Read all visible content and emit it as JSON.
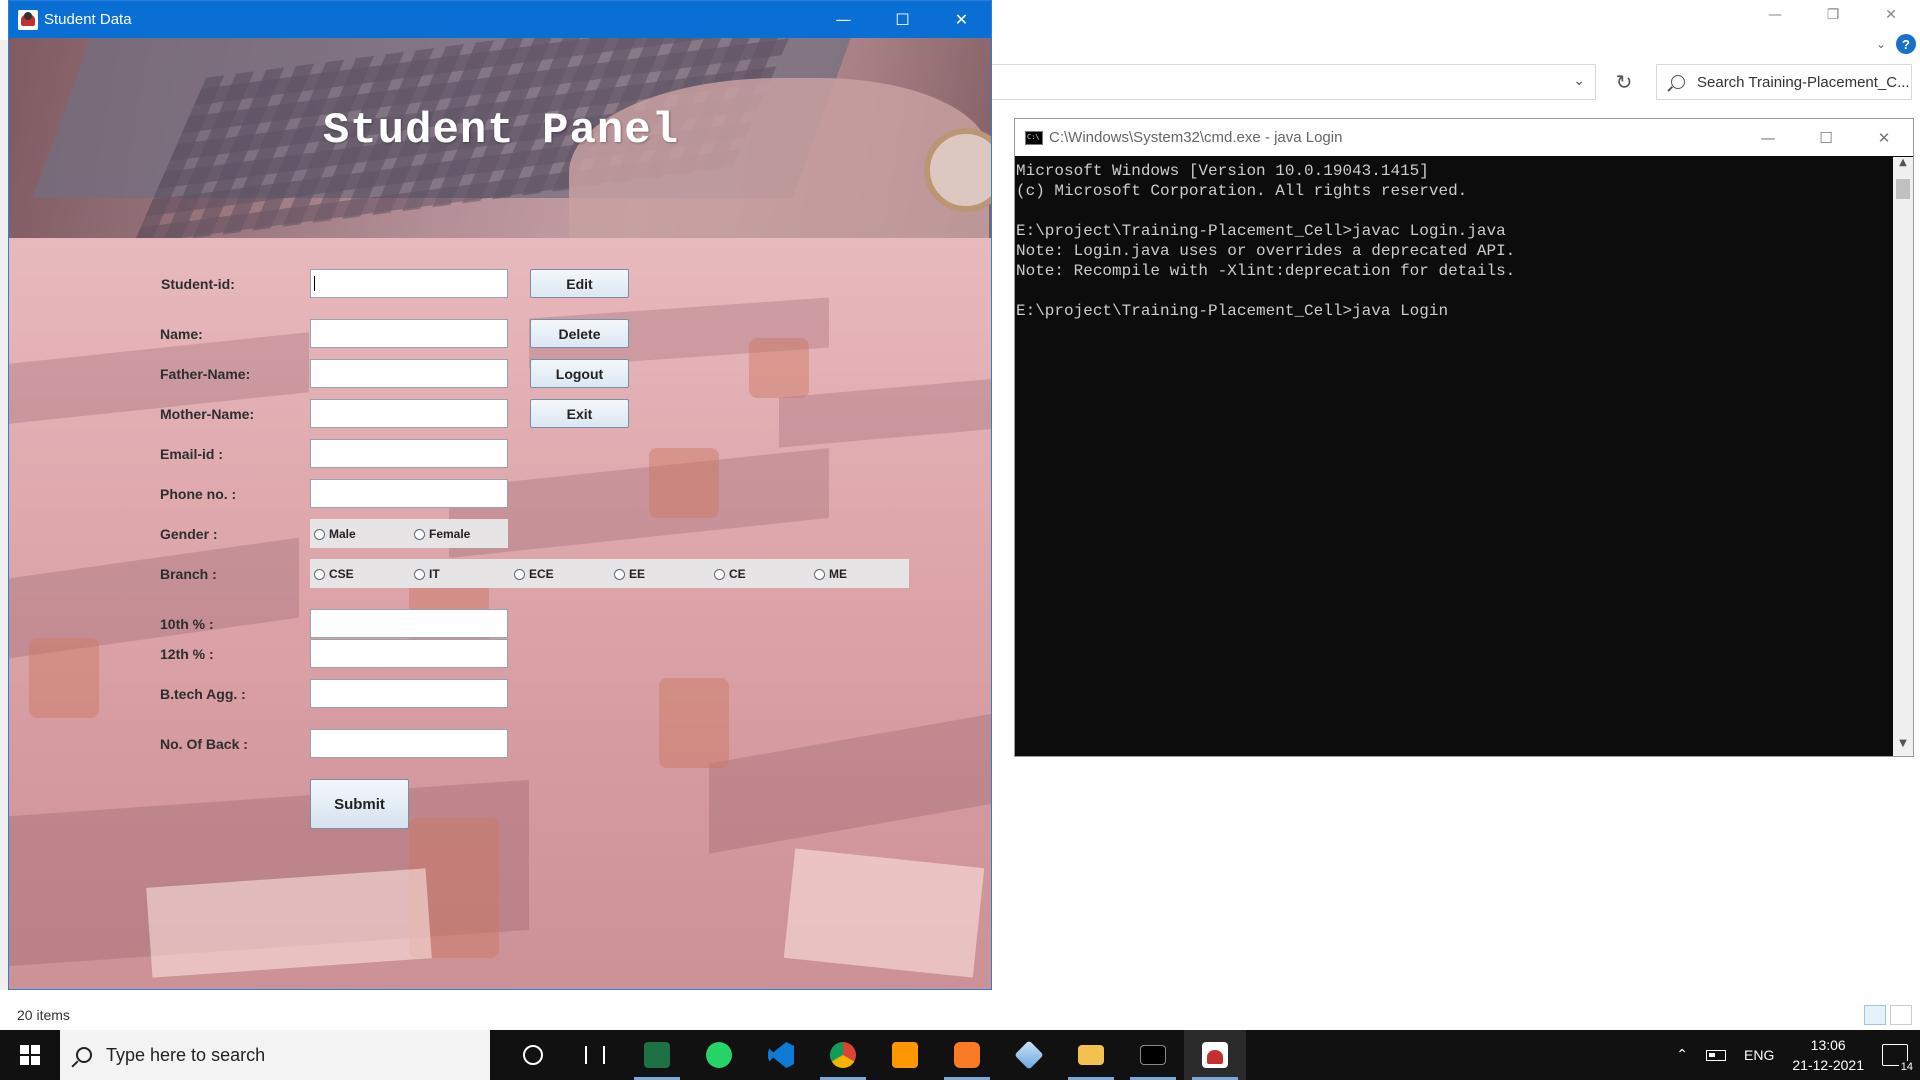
{
  "explorer": {
    "search_placeholder": "Search Training-Placement_C...",
    "status_items": "20 items"
  },
  "java_window": {
    "title": "Student Data",
    "banner_title": "Student Panel",
    "labels": {
      "student_id": "Student-id:",
      "name": "Name:",
      "father_name": "Father-Name:",
      "mother_name": "Mother-Name:",
      "email": "Email-id :",
      "phone": "Phone no. :",
      "gender": "Gender :",
      "branch": "Branch :",
      "tenth": "10th % :",
      "twelfth": "12th % :",
      "btech": "B.tech Agg. :",
      "backs": "No. Of Back :"
    },
    "buttons": {
      "edit": "Edit",
      "delete": "Delete",
      "logout": "Logout",
      "exit": "Exit",
      "submit": "Submit"
    },
    "gender_options": [
      "Male",
      "Female"
    ],
    "branch_options": [
      "CSE",
      "IT",
      "ECE",
      "EE",
      "CE",
      "ME"
    ]
  },
  "cmd_window": {
    "title": "C:\\Windows\\System32\\cmd.exe - java  Login",
    "lines": [
      "Microsoft Windows [Version 10.0.19043.1415]",
      "(c) Microsoft Corporation. All rights reserved.",
      "",
      "E:\\project\\Training-Placement_Cell>javac Login.java",
      "Note: Login.java uses or overrides a deprecated API.",
      "Note: Recompile with -Xlint:deprecation for details.",
      "",
      "E:\\project\\Training-Placement_Cell>java Login"
    ]
  },
  "taskbar": {
    "search_placeholder": "Type here to search",
    "icons": [
      "cortana-icon",
      "task-view-icon",
      "excel-icon",
      "whatsapp-icon",
      "vscode-icon",
      "chrome-icon",
      "sublime-text-icon",
      "xampp-icon",
      "3d-viewer-icon",
      "file-explorer-icon",
      "terminal-icon",
      "java-app-icon"
    ],
    "language": "ENG",
    "time": "13:06",
    "date": "21-12-2021",
    "notification_count": "14"
  },
  "colors": {
    "java_titlebar": "#0a6fd4",
    "taskbar": "#111111",
    "cmd_background": "#0c0c0c",
    "form_tint": "#dfa9ae"
  }
}
